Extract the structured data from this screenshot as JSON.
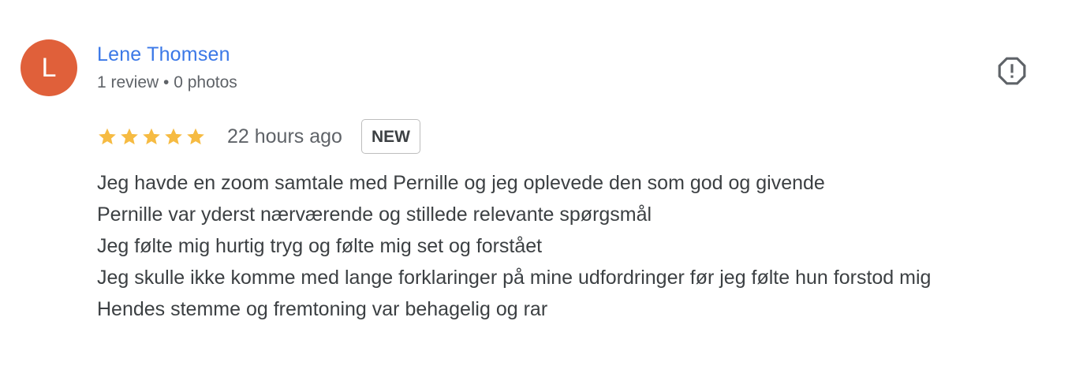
{
  "review": {
    "avatar_letter": "L",
    "avatar_color": "#e0603a",
    "author_name": "Lene Thomsen",
    "author_meta": "1 review • 0 photos",
    "rating": 5,
    "rating_max": 5,
    "time_ago": "22 hours ago",
    "badge": "NEW",
    "flag_icon": "report-flag-icon",
    "lines": [
      "Jeg havde en zoom samtale med Pernille og jeg oplevede den som god og givende",
      "Pernille var yderst nærværende og stillede relevante spørgsmål",
      "Jeg følte mig hurtig tryg og følte mig set og forstået",
      "Jeg skulle ikke komme med lange forklaringer på mine udfordringer før jeg følte hun forstod mig",
      "Hendes stemme og fremtoning var behagelig og rar"
    ]
  },
  "colors": {
    "link": "#3b78e7",
    "star": "#f6bb42",
    "text": "#3c4043",
    "muted": "#5f6368"
  }
}
